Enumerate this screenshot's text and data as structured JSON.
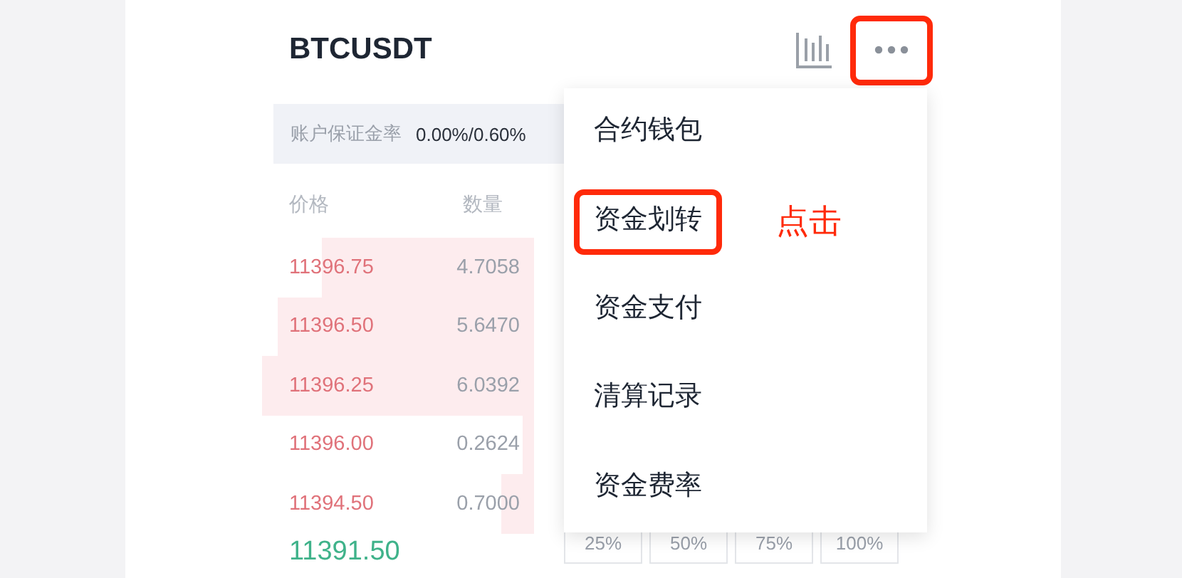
{
  "header": {
    "symbol": "BTCUSDT",
    "more_highlighted": true
  },
  "margin": {
    "label": "账户保证金率",
    "value": "0.00%/0.60%"
  },
  "book": {
    "columns": [
      "价格",
      "数量"
    ],
    "asks": [
      {
        "price": "11396.75",
        "amount": "4.7058"
      },
      {
        "price": "11396.50",
        "amount": "5.6470"
      },
      {
        "price": "11396.25",
        "amount": "6.0392"
      },
      {
        "price": "11396.00",
        "amount": "0.2624"
      },
      {
        "price": "11394.50",
        "amount": "0.7000"
      }
    ],
    "last_price": "11391.50"
  },
  "percent_buttons": [
    "25%",
    "50%",
    "75%",
    "100%"
  ],
  "menu": {
    "items": [
      {
        "label": "合约钱包",
        "highlighted": false
      },
      {
        "label": "资金划转",
        "highlighted": true
      },
      {
        "label": "资金支付",
        "highlighted": false
      },
      {
        "label": "清算记录",
        "highlighted": false
      },
      {
        "label": "资金费率",
        "highlighted": false
      }
    ]
  },
  "annotation": "点击"
}
